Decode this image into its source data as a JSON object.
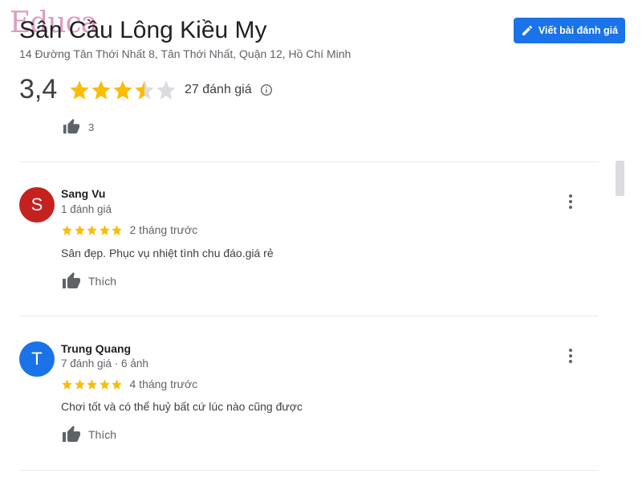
{
  "watermark": "Educa",
  "place": {
    "name": "Sân Cầu Lông Kiều My",
    "address": "14 Đường Tân Thới Nhất 8, Tân Thới Nhất, Quận 12, Hồ Chí Minh"
  },
  "write_review_label": "Viết bài đánh giá",
  "rating": {
    "value": "3,4",
    "stars": 3.5,
    "count_label": "27 đánh giá"
  },
  "top_like_count": "3",
  "reviews": [
    {
      "avatar_letter": "S",
      "avatar_color": "#c5221f",
      "name": "Sang Vu",
      "meta": "1 đánh giá",
      "stars": 5,
      "time": "2 tháng trước",
      "text": "Sân đẹp. Phục vụ nhiệt tình chu đáo.giá rẻ",
      "like_label": "Thích"
    },
    {
      "avatar_letter": "T",
      "avatar_color": "#1a73e8",
      "name": "Trung Quang",
      "meta": "7 đánh giá · 6 ảnh",
      "stars": 5,
      "time": "4 tháng trước",
      "text": "Chơi tốt và có thể huỷ bất cứ lúc nào cũng được",
      "like_label": "Thích"
    }
  ],
  "colors": {
    "star": "#fbbc04",
    "star_empty": "#dadce0",
    "accent": "#1a73e8"
  }
}
